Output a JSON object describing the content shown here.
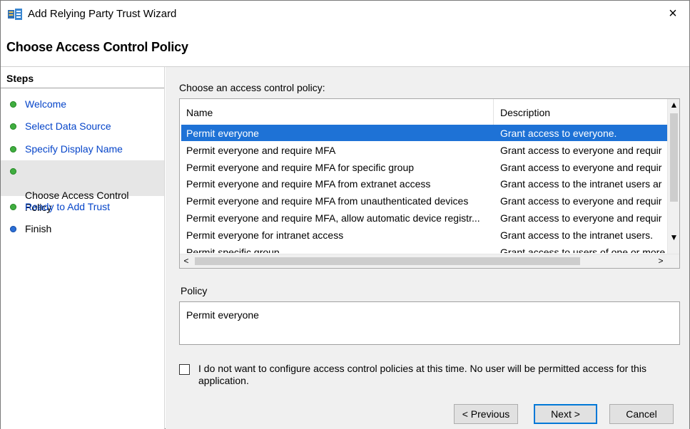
{
  "window": {
    "title": "Add Relying Party Trust Wizard",
    "close_symbol": "×"
  },
  "page": {
    "title": "Choose Access Control Policy"
  },
  "steps": {
    "title": "Steps",
    "items": [
      {
        "label": "Welcome",
        "status": "complete"
      },
      {
        "label": "Select Data Source",
        "status": "complete"
      },
      {
        "label": "Specify Display Name",
        "status": "complete"
      },
      {
        "label": "Choose Access Control\nPolicy",
        "status": "current"
      },
      {
        "label": "Ready to Add Trust",
        "status": "complete"
      },
      {
        "label": "Finish",
        "status": "pending"
      }
    ]
  },
  "policies": {
    "label": "Choose an access control policy:",
    "columns": {
      "name": "Name",
      "description": "Description"
    },
    "rows": [
      {
        "name": "Permit everyone",
        "description": "Grant access to everyone.",
        "selected": true
      },
      {
        "name": "Permit everyone and require MFA",
        "description": "Grant access to everyone and requir"
      },
      {
        "name": "Permit everyone and require MFA for specific group",
        "description": "Grant access to everyone and requir"
      },
      {
        "name": "Permit everyone and require MFA from extranet access",
        "description": "Grant access to the intranet users ar"
      },
      {
        "name": "Permit everyone and require MFA from unauthenticated devices",
        "description": "Grant access to everyone and requir"
      },
      {
        "name": "Permit everyone and require MFA, allow automatic device registr...",
        "description": "Grant access to everyone and requir"
      },
      {
        "name": "Permit everyone for intranet access",
        "description": "Grant access to the intranet users."
      },
      {
        "name": "Permit specific group",
        "description": "Grant access to users of one or more"
      }
    ],
    "scroll_arrows": {
      "up": "▲",
      "down": "▼",
      "left": "<",
      "right": ">"
    }
  },
  "policy": {
    "label": "Policy",
    "value": "Permit everyone"
  },
  "no_config_checkbox": {
    "checked": false,
    "label": "I do not want to configure access control policies at this time. No user will be permitted access for this application."
  },
  "buttons": {
    "previous": "< Previous",
    "next": "Next >",
    "cancel": "Cancel"
  },
  "colors": {
    "selection": "#1e72d6",
    "link": "#0645c9",
    "step_complete": "#3fae3f",
    "step_pending": "#2b6fd6"
  }
}
